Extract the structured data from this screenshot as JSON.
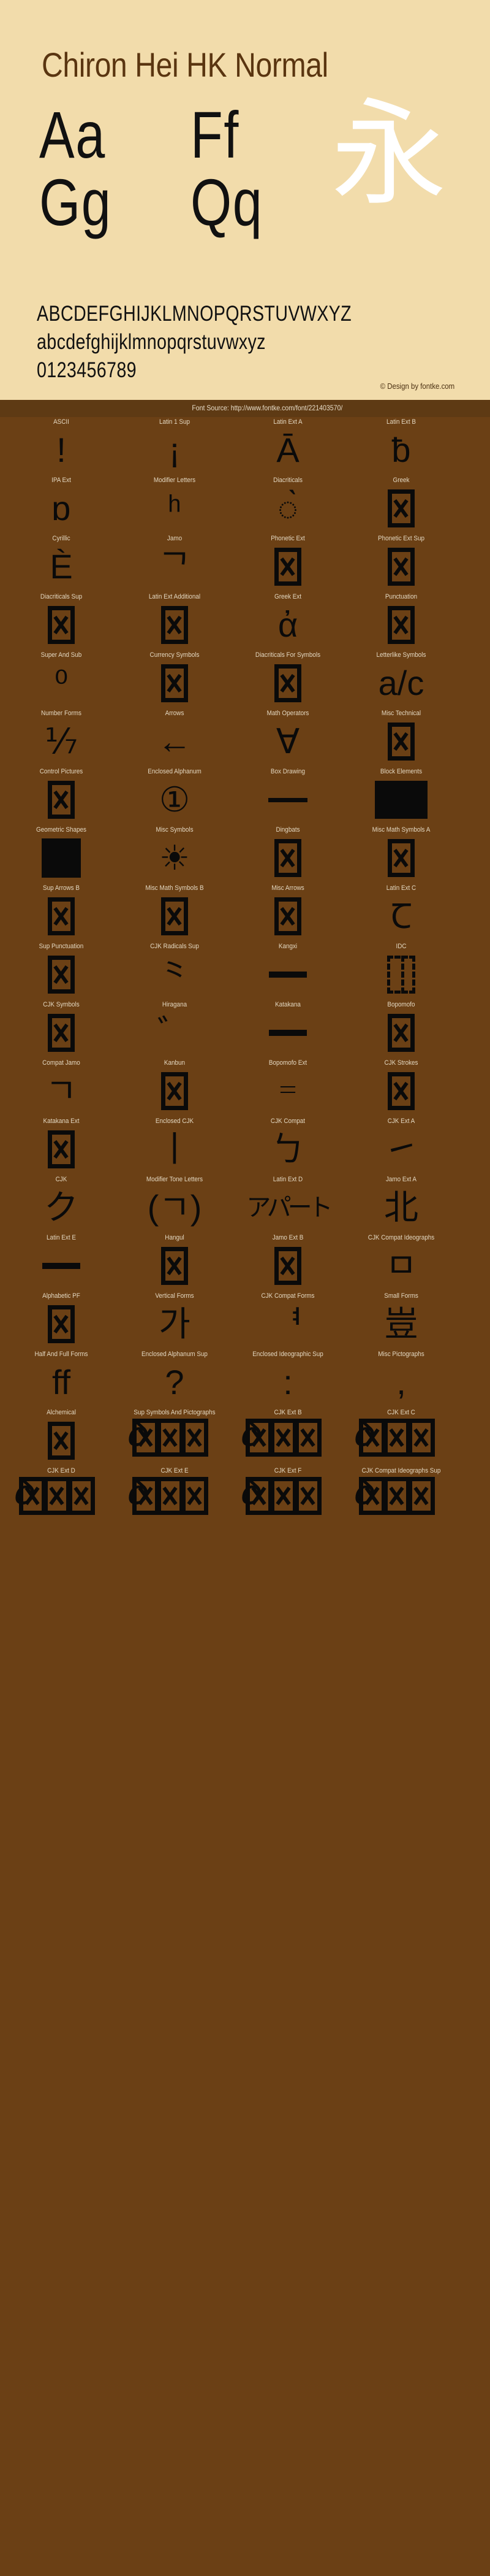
{
  "header": {
    "title": "Chiron Hei HK Normal",
    "specimen_col1": "Aa\nGg",
    "specimen_col2": "Ff\nQq",
    "specimen_glyph": "永",
    "uppercase": "ABCDEFGHIJKLMNOPQRSTUVWXYZ",
    "lowercase": "abcdefghijklmnopqrstuvwxyz",
    "digits": "0123456789",
    "credit": "© Design by fontke.com",
    "background_color": "#f2dcab",
    "title_color": "#5a3510",
    "glyph_color": "#ffffff"
  },
  "source_bar": {
    "text": "Font Source: http://www.fontke.com/font/221403570/",
    "background_color": "#5e3a14",
    "text_color": "#e8ddc8"
  },
  "page": {
    "background_color": "#6b4015",
    "label_color": "#e3d7c0",
    "glyph_color": "#0a0a0a"
  },
  "blocks": [
    [
      {
        "label": "ASCII",
        "glyph": "!",
        "kind": "text"
      },
      {
        "label": "Latin 1 Sup",
        "glyph": "¡",
        "kind": "text"
      },
      {
        "label": "Latin Ext A",
        "glyph": "Ā",
        "kind": "text"
      },
      {
        "label": "Latin Ext B",
        "glyph": "ƀ",
        "kind": "text"
      }
    ],
    [
      {
        "label": "IPA Ext",
        "glyph": "ɒ",
        "kind": "text"
      },
      {
        "label": "Modifier Letters",
        "glyph": "ʰ",
        "kind": "text"
      },
      {
        "label": "Diacriticals",
        "glyph": "◌̀",
        "kind": "text"
      },
      {
        "label": "Greek",
        "glyph": "",
        "kind": "tofu"
      }
    ],
    [
      {
        "label": "Cyrillic",
        "glyph": "Ѐ",
        "kind": "text"
      },
      {
        "label": "Jamo",
        "glyph": "ᄀ",
        "kind": "text"
      },
      {
        "label": "Phonetic Ext",
        "glyph": "",
        "kind": "tofu"
      },
      {
        "label": "Phonetic Ext Sup",
        "glyph": "",
        "kind": "tofu"
      }
    ],
    [
      {
        "label": "Diacriticals Sup",
        "glyph": "",
        "kind": "tofu"
      },
      {
        "label": "Latin Ext Additional",
        "glyph": "",
        "kind": "tofu"
      },
      {
        "label": "Greek Ext",
        "glyph": "ἀ",
        "kind": "text"
      },
      {
        "label": "Punctuation",
        "glyph": "",
        "kind": "tofu"
      }
    ],
    [
      {
        "label": "Super And Sub",
        "glyph": "⁰",
        "kind": "text"
      },
      {
        "label": "Currency Symbols",
        "glyph": "",
        "kind": "tofu"
      },
      {
        "label": "Diacriticals For Symbols",
        "glyph": "",
        "kind": "tofu"
      },
      {
        "label": "Letterlike Symbols",
        "glyph": "a/c",
        "kind": "text"
      }
    ],
    [
      {
        "label": "Number Forms",
        "glyph": "⅐",
        "kind": "text"
      },
      {
        "label": "Arrows",
        "glyph": "←",
        "kind": "text"
      },
      {
        "label": "Math Operators",
        "glyph": "∀",
        "kind": "text"
      },
      {
        "label": "Misc Technical",
        "glyph": "",
        "kind": "tofu"
      }
    ],
    [
      {
        "label": "Control Pictures",
        "glyph": "",
        "kind": "tofu"
      },
      {
        "label": "Enclosed Alphanum",
        "glyph": "①",
        "kind": "text"
      },
      {
        "label": "Box Drawing",
        "glyph": "─",
        "kind": "hline"
      },
      {
        "label": "Block Elements",
        "glyph": "█",
        "kind": "block-wide"
      }
    ],
    [
      {
        "label": "Geometric Shapes",
        "glyph": "■",
        "kind": "block-sq"
      },
      {
        "label": "Misc Symbols",
        "glyph": "☀",
        "kind": "text"
      },
      {
        "label": "Dingbats",
        "glyph": "",
        "kind": "tofu"
      },
      {
        "label": "Misc Math Symbols A",
        "glyph": "",
        "kind": "tofu"
      }
    ],
    [
      {
        "label": "Sup Arrows B",
        "glyph": "",
        "kind": "tofu"
      },
      {
        "label": "Misc Math Symbols B",
        "glyph": "",
        "kind": "tofu"
      },
      {
        "label": "Misc Arrows",
        "glyph": "",
        "kind": "tofu"
      },
      {
        "label": "Latin Ext C",
        "glyph": "Ꞇ",
        "kind": "text"
      }
    ],
    [
      {
        "label": "Sup Punctuation",
        "glyph": "",
        "kind": "tofu"
      },
      {
        "label": "CJK Radicals Sup",
        "glyph": "⺀",
        "kind": "text"
      },
      {
        "label": "Kangxi",
        "glyph": "一",
        "kind": "hline-thick"
      },
      {
        "label": "IDC",
        "glyph": "⿰",
        "kind": "tofu-dashed"
      }
    ],
    [
      {
        "label": "CJK Symbols",
        "glyph": "",
        "kind": "tofu"
      },
      {
        "label": "Hiragana",
        "glyph": "゛",
        "kind": "text"
      },
      {
        "label": "Katakana",
        "glyph": "ー",
        "kind": "hline-thick"
      },
      {
        "label": "Bopomofo",
        "glyph": "",
        "kind": "tofu"
      }
    ],
    [
      {
        "label": "Compat Jamo",
        "glyph": "ㄱ",
        "kind": "text"
      },
      {
        "label": "Kanbun",
        "glyph": "",
        "kind": "tofu"
      },
      {
        "label": "Bopomofo Ext",
        "glyph": "゠",
        "kind": "text"
      },
      {
        "label": "CJK Strokes",
        "glyph": "",
        "kind": "tofu"
      }
    ],
    [
      {
        "label": "Katakana Ext",
        "glyph": "",
        "kind": "tofu"
      },
      {
        "label": "Enclosed CJK",
        "glyph": "丨",
        "kind": "text"
      },
      {
        "label": "CJK Compat",
        "glyph": "ㄅ",
        "kind": "text"
      },
      {
        "label": "CJK Ext A",
        "glyph": "㇀",
        "kind": "text"
      }
    ],
    [
      {
        "label": "CJK",
        "glyph": "ク",
        "kind": "text"
      },
      {
        "label": "Modifier Tone Letters",
        "glyph": "(ㄱ)",
        "kind": "text"
      },
      {
        "label": "Latin Ext D",
        "glyph": "アパート",
        "kind": "multi"
      },
      {
        "label": "Jamo Ext A",
        "glyph": "北",
        "kind": "text"
      }
    ],
    [
      {
        "label": "Latin Ext E",
        "glyph": "一",
        "kind": "hline-thick"
      },
      {
        "label": "Hangul",
        "glyph": "",
        "kind": "tofu"
      },
      {
        "label": "Jamo Ext B",
        "glyph": "",
        "kind": "tofu"
      },
      {
        "label": "CJK Compat Ideographs",
        "glyph": "ㅁ",
        "kind": "text"
      }
    ],
    [
      {
        "label": "Alphabetic PF",
        "glyph": "",
        "kind": "tofu"
      },
      {
        "label": "Vertical Forms",
        "glyph": "가",
        "kind": "text"
      },
      {
        "label": "CJK Compat Forms",
        "glyph": "ᅧ",
        "kind": "text"
      },
      {
        "label": "Small Forms",
        "glyph": "豈",
        "kind": "text"
      }
    ],
    [
      {
        "label": "Half And Full Forms",
        "glyph": "ff",
        "kind": "text"
      },
      {
        "label": "Enclosed Alphanum Sup",
        "glyph": "?",
        "kind": "text"
      },
      {
        "label": "Enclosed Ideographic Sup",
        "glyph": ":",
        "kind": "text"
      },
      {
        "label": "Misc Pictographs",
        "glyph": ",",
        "kind": "text"
      }
    ],
    [
      {
        "label": "Alchemical",
        "glyph": "",
        "kind": "tofu"
      },
      {
        "label": "Sup Symbols And Pictographs",
        "glyph": "𝛿",
        "kind": "tofu-overlap"
      },
      {
        "label": "CJK Ext B",
        "glyph": "",
        "kind": "tofu-overlap"
      },
      {
        "label": "CJK Ext C",
        "glyph": "",
        "kind": "tofu-overlap"
      }
    ],
    [
      {
        "label": "CJK Ext D",
        "glyph": "𝛿",
        "kind": "tofu-overlap"
      },
      {
        "label": "CJK Ext E",
        "glyph": "",
        "kind": "tofu-overlap"
      },
      {
        "label": "CJK Ext F",
        "glyph": "",
        "kind": "tofu-overlap"
      },
      {
        "label": "CJK Compat Ideographs Sup",
        "glyph": "",
        "kind": "tofu-overlap"
      }
    ]
  ]
}
